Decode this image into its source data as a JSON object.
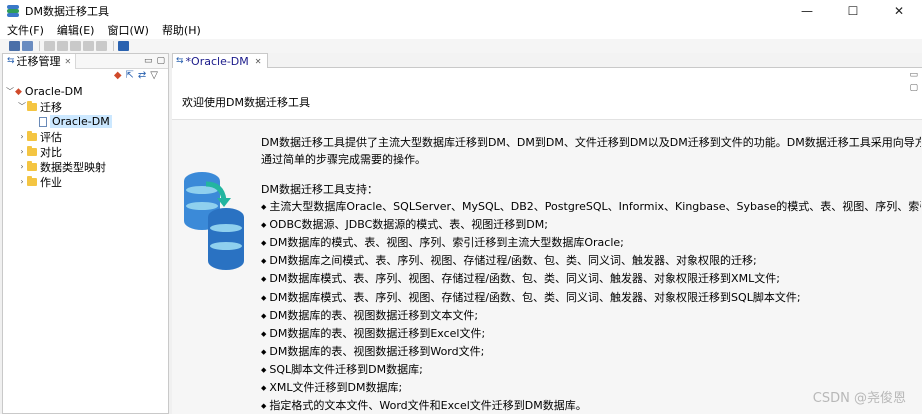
{
  "window": {
    "title": "DM数据迁移工具",
    "controls": [
      "—",
      "☐",
      "✕"
    ]
  },
  "menu": [
    "文件(F)",
    "编辑(E)",
    "窗口(W)",
    "帮助(H)"
  ],
  "left_pane": {
    "tab_label": "迁移管理",
    "tree": {
      "root": "Oracle-DM",
      "migrate_folder": "迁移",
      "selected_item": "Oracle-DM",
      "folders": [
        "评估",
        "对比",
        "数据类型映射",
        "作业"
      ]
    }
  },
  "editor": {
    "tab_label": "*Oracle-DM",
    "welcome_title": "欢迎使用DM数据迁移工具",
    "intro_lines": [
      "DM数据迁移工具提供了主流大型数据库迁移到DM、DM到DM、文件迁移到DM以及DM迁移到文件的功能。DM数据迁移工具采用向导方式引导用户",
      "通过简单的步骤完成需要的操作。"
    ],
    "support_title": "DM数据迁移工具支持：",
    "features": [
      "主流大型数据库Oracle、SQLServer、MySQL、DB2、PostgreSQL、Informix、Kingbase、Sybase的模式、表、视图、序列、索引迁移到DM;",
      "ODBC数据源、JDBC数据源的模式、表、视图迁移到DM;",
      "DM数据库的模式、表、视图、序列、索引迁移到主流大型数据库Oracle;",
      "DM数据库之间模式、表、序列、视图、存储过程/函数、包、类、同义词、触发器、对象权限的迁移;",
      "DM数据库模式、表、序列、视图、存储过程/函数、包、类、同义词、触发器、对象权限迁移到XML文件;",
      "DM数据库模式、表、序列、视图、存储过程/函数、包、类、同义词、触发器、对象权限迁移到SQL脚本文件;",
      "DM数据库的表、视图数据迁移到文本文件;",
      "DM数据库的表、视图数据迁移到Excel文件;",
      "DM数据库的表、视图数据迁移到Word文件;",
      "SQL脚本文件迁移到DM数据库;",
      "XML文件迁移到DM数据库;",
      "指定格式的文本文件、Word文件和Excel文件迁移到DM数据库。"
    ]
  },
  "watermark": "CSDN @尧俊恩"
}
